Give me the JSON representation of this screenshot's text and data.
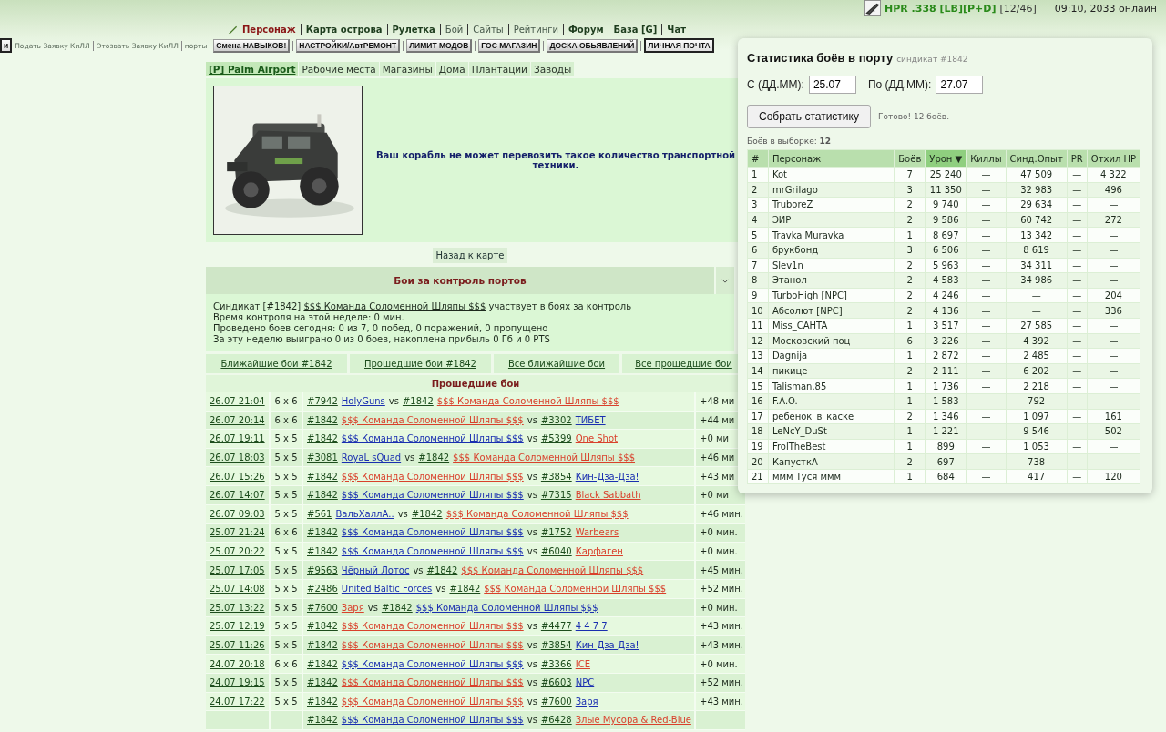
{
  "top_status": {
    "character": "HPR .338 [LB][P+D]",
    "slots": "[12/46]",
    "online": "09:10, 2033 онлайн"
  },
  "nav_primary": [
    {
      "label": "Персонаж",
      "kind": "accent"
    },
    {
      "label": "Карта острова",
      "kind": "bold"
    },
    {
      "label": "Рулетка",
      "kind": "bold"
    },
    {
      "label": "Бой",
      "kind": "plain"
    },
    {
      "label": "Сайты",
      "kind": "plain"
    },
    {
      "label": "Рейтинги",
      "kind": "plain"
    },
    {
      "label": "Форум",
      "kind": "bold"
    },
    {
      "label": "База [G]",
      "kind": "bold"
    },
    {
      "label": "Чат",
      "kind": "bold"
    }
  ],
  "nav_secondary": [
    {
      "label": "и",
      "kind": "button",
      "highlighted": true
    },
    {
      "label": "Подать Заявку КиЛЛ",
      "kind": "link"
    },
    {
      "label": "Отозвать Заявку КиЛЛ",
      "kind": "link"
    },
    {
      "label": "порты",
      "kind": "link"
    },
    {
      "label": "Смена НАВЫКОВ!",
      "kind": "button",
      "highlighted": false
    },
    {
      "label": "НАСТРОЙКИ/АвтРЕМОНТ",
      "kind": "button",
      "highlighted": false
    },
    {
      "label": "ЛИМИТ МОДОВ",
      "kind": "button",
      "highlighted": false
    },
    {
      "label": "ГОС МАГАЗИН",
      "kind": "button",
      "highlighted": false
    },
    {
      "label": "ДОСКА ОБЬЯВЛЕНИЙ",
      "kind": "button",
      "highlighted": false
    },
    {
      "label": "ЛИЧНАЯ ПОЧТА",
      "kind": "button",
      "highlighted": true
    }
  ],
  "location_tabs": [
    {
      "label": "[P] Palm Airport",
      "selected": true
    },
    {
      "label": "Рабочие места",
      "selected": false
    },
    {
      "label": "Магазины",
      "selected": false
    },
    {
      "label": "Дома",
      "selected": false
    },
    {
      "label": "Плантации",
      "selected": false
    },
    {
      "label": "Заводы",
      "selected": false
    }
  ],
  "vehicle": {
    "kind": "picture",
    "message": "Ваш корабль не может перевозить такое количество транспортной техники."
  },
  "back_button": "Назад к карте",
  "port_battles": {
    "title": "Бои за контроль портов",
    "info": {
      "before": "Синдикат [#1842]",
      "link": "$$$ Команда Соломенной Шляпы $$$",
      "after": "участвует в боях за контроль"
    },
    "lines": [
      "Время контроля на этой неделе: 0 мин.",
      "Проведено боев сегодня: 0 из 7, 0 побед, 0 поражений, 0 пропущено",
      "За эту неделю выиграно 0 из 0 боев, накоплена прибыль 0 Гб и 0 PTS"
    ],
    "links": [
      "Ближайшие бои #1842",
      "Прошедшие бои #1842",
      "Все ближайшие бои",
      "Все прошедшие бои"
    ],
    "past_title": "Прошедшие бои",
    "battles": [
      {
        "date": "26.07 21:04",
        "format": "6 x 6",
        "a": {
          "tag": "#7942",
          "name": "HolyGuns",
          "color": "#1a2fb0"
        },
        "vs": "vs",
        "b": {
          "tag": "#1842",
          "name": "$$$ Команда Соломенной Шляпы $$$",
          "color": "#d9412c"
        },
        "result": "+48 ми"
      },
      {
        "date": "26.07 20:14",
        "format": "6 x 6",
        "a": {
          "tag": "#1842",
          "name": "$$$ Команда Соломенной Шляпы $$$",
          "color": "#d9412c"
        },
        "vs": "vs",
        "b": {
          "tag": "#3302",
          "name": "ТИБЕТ",
          "color": "#1a2fb0"
        },
        "result": "+44 ми"
      },
      {
        "date": "26.07 19:11",
        "format": "5 x 5",
        "a": {
          "tag": "#1842",
          "name": "$$$ Команда Соломенной Шляпы $$$",
          "color": "#1a2fb0"
        },
        "vs": "vs",
        "b": {
          "tag": "#5399",
          "name": "One Shot",
          "color": "#d9412c"
        },
        "result": "+0 ми"
      },
      {
        "date": "26.07 18:03",
        "format": "5 x 5",
        "a": {
          "tag": "#3081",
          "name": "RoyaL sQuad",
          "color": "#1a2fb0"
        },
        "vs": "vs",
        "b": {
          "tag": "#1842",
          "name": "$$$ Команда Соломенной Шляпы $$$",
          "color": "#d9412c"
        },
        "result": "+46 ми"
      },
      {
        "date": "26.07 15:26",
        "format": "5 x 5",
        "a": {
          "tag": "#1842",
          "name": "$$$ Команда Соломенной Шляпы $$$",
          "color": "#d9412c"
        },
        "vs": "vs",
        "b": {
          "tag": "#3854",
          "name": "Кин-Дза-Дза!",
          "color": "#1a2fb0"
        },
        "result": "+43 ми"
      },
      {
        "date": "26.07 14:07",
        "format": "5 x 5",
        "a": {
          "tag": "#1842",
          "name": "$$$ Команда Соломенной Шляпы $$$",
          "color": "#1a2fb0"
        },
        "vs": "vs",
        "b": {
          "tag": "#7315",
          "name": "Black Sabbath",
          "color": "#d9412c"
        },
        "result": "+0 ми"
      },
      {
        "date": "26.07 09:03",
        "format": "5 x 5",
        "a": {
          "tag": "#561",
          "name": "ВальХаллА..",
          "color": "#1a2fb0"
        },
        "vs": "vs",
        "b": {
          "tag": "#1842",
          "name": "$$$ Команда Соломенной Шляпы $$$",
          "color": "#d9412c"
        },
        "result": "+46 мин."
      },
      {
        "date": "25.07 21:24",
        "format": "6 x 6",
        "a": {
          "tag": "#1842",
          "name": "$$$ Команда Соломенной Шляпы $$$",
          "color": "#1a2fb0"
        },
        "vs": "vs",
        "b": {
          "tag": "#1752",
          "name": "Warbears",
          "color": "#d9412c"
        },
        "result": "+0 мин."
      },
      {
        "date": "25.07 20:22",
        "format": "5 x 5",
        "a": {
          "tag": "#1842",
          "name": "$$$ Команда Соломенной Шляпы $$$",
          "color": "#1a2fb0"
        },
        "vs": "vs",
        "b": {
          "tag": "#6040",
          "name": "Карфаген",
          "color": "#d9412c"
        },
        "result": "+0 мин."
      },
      {
        "date": "25.07 17:05",
        "format": "5 x 5",
        "a": {
          "tag": "#9563",
          "name": "Чёрный Лотос",
          "color": "#1a2fb0"
        },
        "vs": "vs",
        "b": {
          "tag": "#1842",
          "name": "$$$ Команда Соломенной Шляпы $$$",
          "color": "#d9412c"
        },
        "result": "+45 мин."
      },
      {
        "date": "25.07 14:08",
        "format": "5 x 5",
        "a": {
          "tag": "#2486",
          "name": "United Baltic Forces",
          "color": "#1a2fb0"
        },
        "vs": "vs",
        "b": {
          "tag": "#1842",
          "name": "$$$ Команда Соломенной Шляпы $$$",
          "color": "#d9412c"
        },
        "result": "+52 мин."
      },
      {
        "date": "25.07 13:22",
        "format": "5 x 5",
        "a": {
          "tag": "#7600",
          "name": "Заря",
          "color": "#d9412c"
        },
        "vs": "vs",
        "b": {
          "tag": "#1842",
          "name": "$$$ Команда Соломенной Шляпы $$$",
          "color": "#1a2fb0"
        },
        "result": "+0 мин."
      },
      {
        "date": "25.07 12:19",
        "format": "5 x 5",
        "a": {
          "tag": "#1842",
          "name": "$$$ Команда Соломенной Шляпы $$$",
          "color": "#d9412c"
        },
        "vs": "vs",
        "b": {
          "tag": "#4477",
          "name": "4 4 7 7",
          "color": "#1a2fb0"
        },
        "result": "+43 мин."
      },
      {
        "date": "25.07 11:26",
        "format": "5 x 5",
        "a": {
          "tag": "#1842",
          "name": "$$$ Команда Соломенной Шляпы $$$",
          "color": "#d9412c"
        },
        "vs": "vs",
        "b": {
          "tag": "#3854",
          "name": "Кин-Дза-Дза!",
          "color": "#1a2fb0"
        },
        "result": "+43 мин."
      },
      {
        "date": "24.07 20:18",
        "format": "6 x 6",
        "a": {
          "tag": "#1842",
          "name": "$$$ Команда Соломенной Шляпы $$$",
          "color": "#1a2fb0"
        },
        "vs": "vs",
        "b": {
          "tag": "#3366",
          "name": "ICE",
          "color": "#d9412c"
        },
        "result": "+0 мин."
      },
      {
        "date": "24.07 19:15",
        "format": "5 x 5",
        "a": {
          "tag": "#1842",
          "name": "$$$ Команда Соломенной Шляпы $$$",
          "color": "#d9412c"
        },
        "vs": "vs",
        "b": {
          "tag": "#6603",
          "name": "NPC",
          "color": "#1a2fb0"
        },
        "result": "+52 мин."
      },
      {
        "date": "24.07 17:22",
        "format": "5 x 5",
        "a": {
          "tag": "#1842",
          "name": "$$$ Команда Соломенной Шляпы $$$",
          "color": "#d9412c"
        },
        "vs": "vs",
        "b": {
          "tag": "#7600",
          "name": "Заря",
          "color": "#1a2fb0"
        },
        "result": "+43 мин."
      },
      {
        "a": {
          "tag": "#1842",
          "name": "$$$ Команда Соломенной Шляпы $$$",
          "color": "#1a2fb0"
        },
        "vs": "vs",
        "b": {
          "tag": "#6428",
          "name": "Злые Мусора & Red-Blue",
          "color": "#d9412c"
        }
      }
    ]
  },
  "stats_popup": {
    "title": "Статистика боёв в порту",
    "subtitle": "синдикат #1842",
    "from_label": "С (ДД.ММ):",
    "from_value": "25.07",
    "to_label": "По (ДД.ММ):",
    "to_value": "27.07",
    "button": "Собрать статистику",
    "status": "Готово! 12 боёв.",
    "count": "Боёв в выборке: **12**",
    "columns": [
      {
        "label": "#",
        "selected": false
      },
      {
        "label": "Персонаж",
        "selected": false
      },
      {
        "label": "Боёв",
        "selected": false
      },
      {
        "label": "Урон ▼",
        "selected": true
      },
      {
        "label": "Киллы",
        "selected": false
      },
      {
        "label": "Синд.Опыт",
        "selected": false
      },
      {
        "label": "PR",
        "selected": false
      },
      {
        "label": "Отхил HP",
        "selected": false
      }
    ],
    "rows": [
      [
        "1",
        "Kot",
        "7",
        "25 240",
        "—",
        "47 509",
        "—",
        "4 322"
      ],
      [
        "2",
        "mrGrilago",
        "3",
        "11 350",
        "—",
        "32 983",
        "—",
        "496"
      ],
      [
        "3",
        "TruboreZ",
        "2",
        "9 740",
        "—",
        "29 634",
        "—",
        "—"
      ],
      [
        "4",
        "ЭИР",
        "2",
        "9 586",
        "—",
        "60 742",
        "—",
        "272"
      ],
      [
        "5",
        "Travka Muravka",
        "1",
        "8 697",
        "—",
        "13 342",
        "—",
        "—"
      ],
      [
        "6",
        "брукбонд",
        "3",
        "6 506",
        "—",
        "8 619",
        "—",
        "—"
      ],
      [
        "7",
        "Slev1n",
        "2",
        "5 963",
        "—",
        "34 311",
        "—",
        "—"
      ],
      [
        "8",
        "Этанол",
        "2",
        "4 583",
        "—",
        "34 986",
        "—",
        "—"
      ],
      [
        "9",
        "TurboHigh [NPC]",
        "2",
        "4 246",
        "—",
        "—",
        "—",
        "204"
      ],
      [
        "10",
        "Абсолют [NPC]",
        "2",
        "4 136",
        "—",
        "—",
        "—",
        "336"
      ],
      [
        "11",
        "Miss_CAHTA",
        "1",
        "3 517",
        "—",
        "27 585",
        "—",
        "—"
      ],
      [
        "12",
        "Московский поц",
        "6",
        "3 226",
        "—",
        "4 392",
        "—",
        "—"
      ],
      [
        "13",
        "Dagnija",
        "1",
        "2 872",
        "—",
        "2 485",
        "—",
        "—"
      ],
      [
        "14",
        "пикице",
        "2",
        "2 111",
        "—",
        "6 202",
        "—",
        "—"
      ],
      [
        "15",
        "Talisman.85",
        "1",
        "1 736",
        "—",
        "2 218",
        "—",
        "—"
      ],
      [
        "16",
        "F.A.O.",
        "1",
        "1 583",
        "—",
        "792",
        "—",
        "—"
      ],
      [
        "17",
        "ребенок_в_каске",
        "2",
        "1 346",
        "—",
        "1 097",
        "—",
        "161"
      ],
      [
        "18",
        "LeNcY_DuSt",
        "1",
        "1 221",
        "—",
        "9 546",
        "—",
        "502"
      ],
      [
        "19",
        "FrolTheBest",
        "1",
        "899",
        "—",
        "1 053",
        "—",
        "—"
      ],
      [
        "20",
        "КапусткА",
        "2",
        "697",
        "—",
        "738",
        "—",
        "—"
      ],
      [
        "21",
        "ммм Туся ммм",
        "1",
        "684",
        "—",
        "417",
        "—",
        "120"
      ]
    ]
  }
}
